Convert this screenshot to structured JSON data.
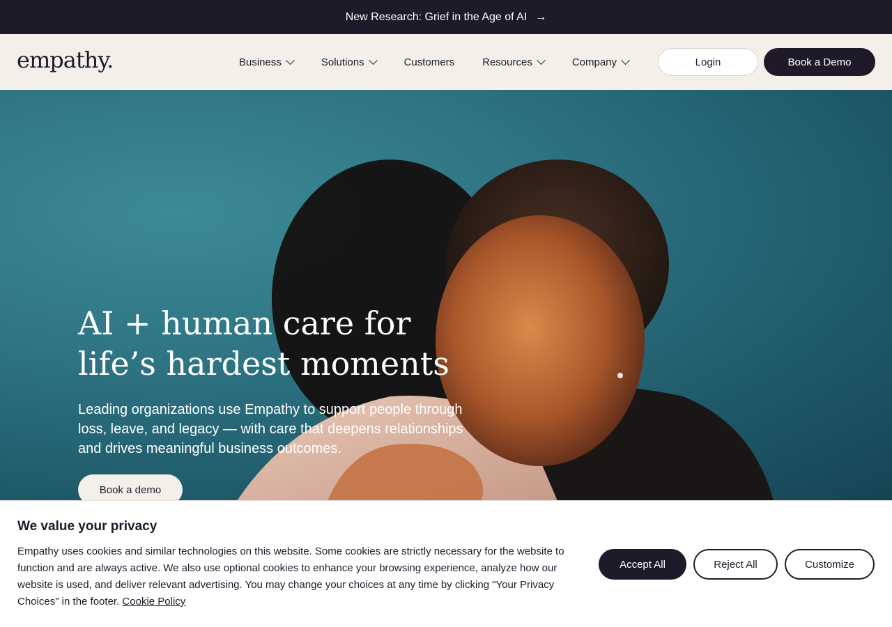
{
  "announcement": {
    "text": "New Research: Grief in the Age of AI",
    "arrow": "→"
  },
  "header": {
    "logo": "empathy.",
    "menu": [
      {
        "label": "Business",
        "has_dropdown": true
      },
      {
        "label": "Solutions",
        "has_dropdown": true
      },
      {
        "label": "Customers",
        "has_dropdown": false
      },
      {
        "label": "Resources",
        "has_dropdown": true
      },
      {
        "label": "Company",
        "has_dropdown": true
      }
    ],
    "login_label": "Login",
    "demo_label": "Book a Demo"
  },
  "hero": {
    "title_line1": "AI + human care for",
    "title_line2": "life’s hardest moments",
    "subtitle": "Leading organizations use Empathy to support people through loss, leave, and legacy — with care that deepens relationships and drives meaningful business outcomes.",
    "cta_label": "Book a demo"
  },
  "cookie_banner": {
    "title": "We value your privacy",
    "text": "Empathy uses cookies and similar technologies on this website. Some cookies are strictly necessary for the website to function and are always active. We also use optional cookies to enhance your browsing experience, analyze how our website is used, and deliver relevant advertising. You may change your choices at any time by clicking \"Your Privacy Choices\" in the footer.",
    "link_label": "Cookie Policy",
    "accept_label": "Accept All",
    "reject_label": "Reject All",
    "customize_label": "Customize"
  },
  "colors": {
    "dark": "#1e1a2a",
    "cream": "#f4efe9",
    "hero_teal": "#2f7584"
  },
  "icons": [
    "arrow-right-icon",
    "chevron-down-icon"
  ]
}
